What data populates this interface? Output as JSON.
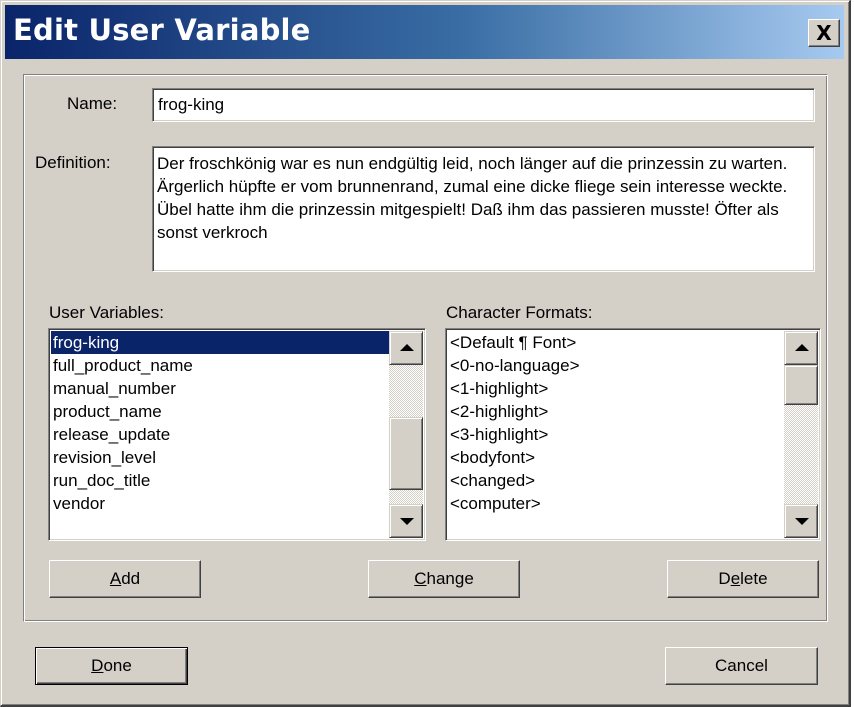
{
  "dialog": {
    "title": "Edit User Variable",
    "close_glyph": "X"
  },
  "name": {
    "label": "Name:",
    "value": "frog-king"
  },
  "definition": {
    "label": "Definition:",
    "text": "Der froschkönig war es nun endgültig leid, noch länger auf die prinzessin zu warten. Ärgerlich hüpfte er vom brunnenrand, zumal eine dicke fliege sein interesse weckte. Übel hatte ihm die prinzessin mitgespielt! Daß ihm das passieren musste! Öfter als sonst verkroch"
  },
  "user_variables": {
    "label": "User Variables:",
    "selected_index": 0,
    "items": [
      "frog-king",
      "full_product_name",
      "manual_number",
      "product_name",
      "release_update",
      "revision_level",
      "run_doc_title",
      "vendor"
    ]
  },
  "character_formats": {
    "label": "Character Formats:",
    "items": [
      "<Default ¶ Font>",
      "<0-no-language>",
      "<1-highlight>",
      "<2-highlight>",
      "<3-highlight>",
      "<bodyfont>",
      "<changed>",
      "<computer>"
    ]
  },
  "buttons": {
    "add": {
      "pre": "",
      "key": "A",
      "post": "dd"
    },
    "change": {
      "pre": "",
      "key": "C",
      "post": "hange"
    },
    "delete": {
      "pre": "D",
      "key": "e",
      "post": "lete"
    },
    "done": {
      "pre": "",
      "key": "D",
      "post": "one"
    },
    "cancel": {
      "pre": "Cancel",
      "key": "",
      "post": ""
    }
  },
  "colors": {
    "title_gradient_start": "#0a246a",
    "title_gradient_end": "#a6caf0",
    "face": "#d4d0c8",
    "selection": "#0a246a"
  }
}
